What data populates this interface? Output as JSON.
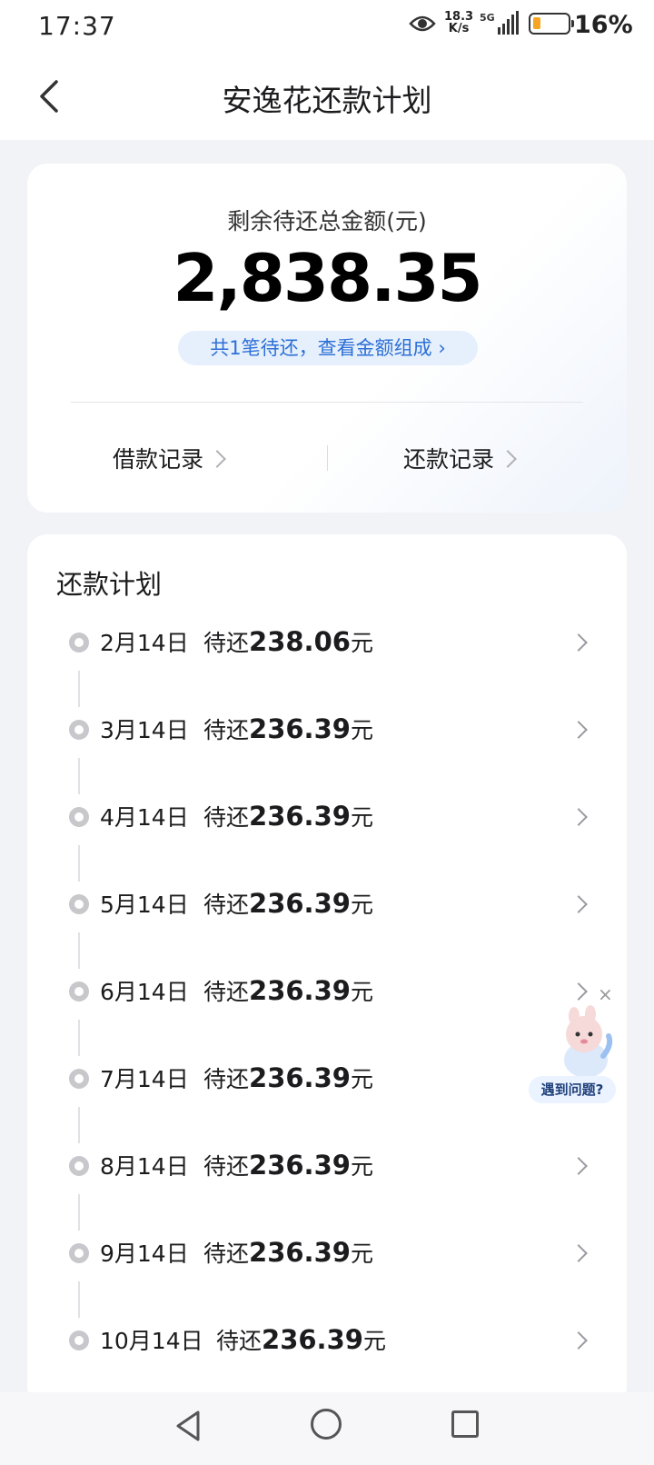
{
  "status": {
    "time": "17:37",
    "speed_top": "18.3",
    "speed_bottom": "K/s",
    "network": "5G",
    "battery": "16%",
    "battery_color": "#f5a623"
  },
  "header": {
    "title": "安逸花还款计划",
    "back_icon": "chevron-left-icon"
  },
  "summary": {
    "label": "剩余待还总金额(元)",
    "amount": "2,838.35",
    "detail_link": "共1笔待还，查看金额组成 ›",
    "borrow_records": "借款记录",
    "repay_records": "还款记录"
  },
  "plan": {
    "title": "还款计划",
    "pending_prefix": "待还",
    "unit": "元",
    "items": [
      {
        "date": "2月14日",
        "amount": "238.06"
      },
      {
        "date": "3月14日",
        "amount": "236.39"
      },
      {
        "date": "4月14日",
        "amount": "236.39"
      },
      {
        "date": "5月14日",
        "amount": "236.39"
      },
      {
        "date": "6月14日",
        "amount": "236.39"
      },
      {
        "date": "7月14日",
        "amount": "236.39"
      },
      {
        "date": "8月14日",
        "amount": "236.39"
      },
      {
        "date": "9月14日",
        "amount": "236.39"
      },
      {
        "date": "10月14日",
        "amount": "236.39"
      }
    ]
  },
  "help": {
    "label": "遇到问题?",
    "close": "×"
  },
  "colors": {
    "accent": "#2c6fd6",
    "pill_bg": "#e6f0fc",
    "background": "#f2f3f7"
  }
}
